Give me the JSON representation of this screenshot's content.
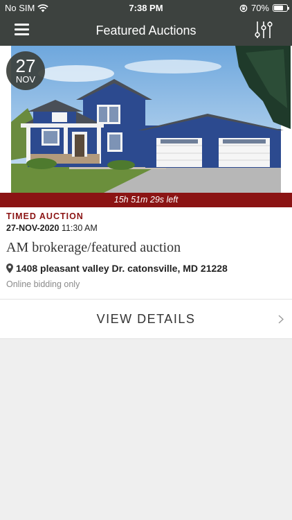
{
  "status_bar": {
    "carrier": "No SIM",
    "time": "7:38 PM",
    "battery_percent": "70%",
    "battery_level": 0.7
  },
  "nav": {
    "title": "Featured Auctions",
    "menu_icon": "hamburger-menu-icon",
    "filter_icon": "sliders-icon"
  },
  "auction": {
    "date_day": "27",
    "date_month": "NOV",
    "countdown": "15h 51m 29s left",
    "type": "TIMED AUCTION",
    "date": "27-NOV-2020",
    "time": "11:30 AM",
    "title": "AM  brokerage/featured auction",
    "address": "1408 pleasant valley Dr. catonsville, MD 21228",
    "note": "Online bidding only"
  },
  "actions": {
    "view_details": "VIEW DETAILS"
  },
  "colors": {
    "nav_bg": "#3d423f",
    "accent_red": "#8b1414",
    "house_blue": "#2c4a8f"
  }
}
